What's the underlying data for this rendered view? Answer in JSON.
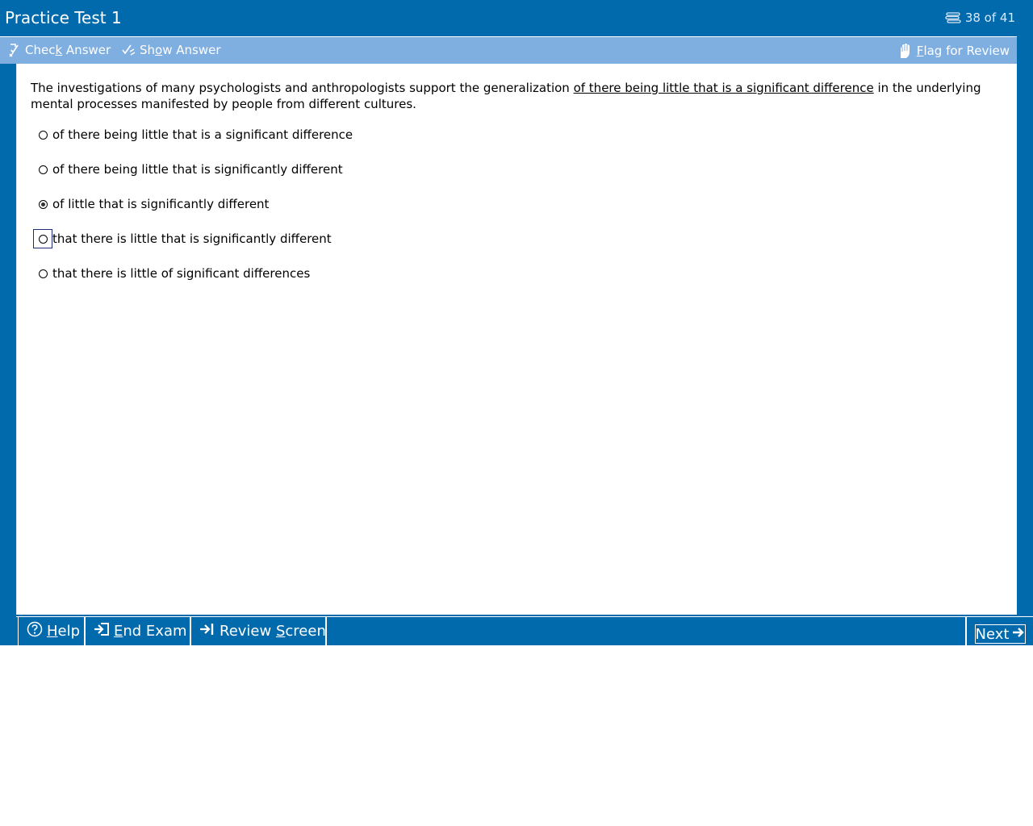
{
  "app": {
    "title": "Practice Test 1",
    "progress": "38 of 41",
    "colors": {
      "primary": "#006aad",
      "toolbar": "#7faee1",
      "content": "#ffffff"
    }
  },
  "toolbar": {
    "check_answer": {
      "pre": "Chec",
      "mn": "k",
      "post": " Answer",
      "icon": "check-pen-icon"
    },
    "show_answer": {
      "pre": "Sh",
      "mn": "o",
      "post": "w Answer",
      "icon": "show-pen-icon"
    },
    "flag_review": {
      "pre": "",
      "mn": "F",
      "post": "lag for Review",
      "icon": "flag-hand-icon"
    }
  },
  "question": {
    "before": "The investigations of many psychologists and anthropologists support the generalization ",
    "underlined": "of there being little that is a significant difference",
    "after": " in the underlying mental processes manifested by people from different cultures."
  },
  "choices": [
    {
      "text": "of there being little that is a significant difference",
      "selected": false,
      "focused": false
    },
    {
      "text": "of there being little that is significantly different",
      "selected": false,
      "focused": false
    },
    {
      "text": "of little that is significantly different",
      "selected": true,
      "focused": false
    },
    {
      "text": "that there is little that is significantly different",
      "selected": false,
      "focused": true
    },
    {
      "text": "that there is little of significant differences",
      "selected": false,
      "focused": false
    }
  ],
  "bottom": {
    "help": {
      "pre": "",
      "mn": "H",
      "post": "elp",
      "icon": "help-circle-icon"
    },
    "end_exam": {
      "pre": "",
      "mn": "E",
      "post": "nd Exam",
      "icon": "end-exam-arrow-icon"
    },
    "review_screen": {
      "pre": "Review ",
      "mn": "S",
      "post": "creen",
      "icon": "review-arrow-icon"
    },
    "next": {
      "label": "Next",
      "icon": "right-arrow-icon"
    }
  }
}
